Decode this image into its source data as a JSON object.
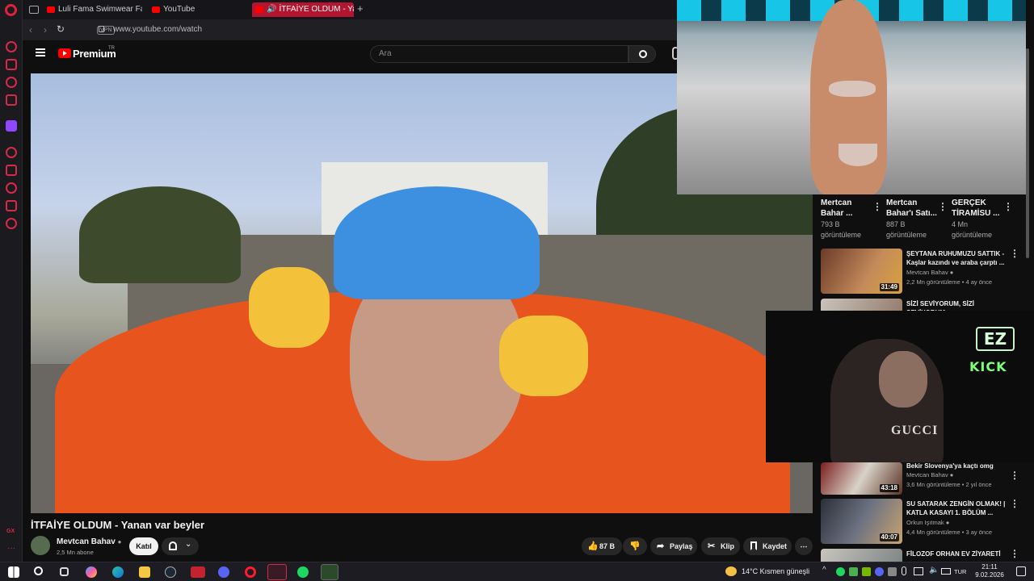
{
  "browser": {
    "tabs": [
      {
        "label": "Luli Fama Swimwear Fashi"
      },
      {
        "label": "YouTube"
      },
      {
        "label": "İTFAİYE OLDUM - Yanan"
      }
    ],
    "vpn_label": "VPN",
    "url": "www.youtube.com/watch"
  },
  "youtube": {
    "brand": "Premium",
    "region": "TR",
    "search_placeholder": "Ara"
  },
  "video": {
    "title": "İTFAİYE OLDUM - Yanan var beyler",
    "channel": "Mevtcan Bahav",
    "subscribers": "2,5 Mn abone",
    "join_label": "Katıl",
    "likes": "87 B",
    "share_label": "Paylaş",
    "clip_label": "Klip",
    "save_label": "Kaydet"
  },
  "stream_overlay": {
    "logo_text": "EZ",
    "platform_text": "KICK",
    "shirt_text": "GUCCI"
  },
  "shorts_chips": [
    {
      "title": "Mertcan",
      "title2": "Bahar ...",
      "views": "793 B",
      "views2": "görüntüleme"
    },
    {
      "title": "Mertcan",
      "title2": "Bahar'ı Satı...",
      "views": "887 B",
      "views2": "görüntüleme"
    },
    {
      "title": "GERÇEK",
      "title2": "TİRAMİSU ...",
      "views": "4 Mn",
      "views2": "görüntüleme"
    }
  ],
  "recommendations": [
    {
      "title": "ŞEYTANA RUHUMUZU SATTIK - Kaşlar kazındı ve araba çarptı ...",
      "channel": "Mevtcan Bahav",
      "meta": "2,2 Mn görüntüleme • 4 ay önce",
      "duration": "31:49"
    },
    {
      "title": "SİZİ SEVİYORUM, SİZİ SEVİYORUM",
      "channel": "",
      "meta": "",
      "duration": ""
    },
    {
      "title": "Bekir Slovenya'ya kaçtı omg",
      "channel": "Mevtcan Bahav",
      "meta": "3,6 Mn görüntüleme • 2 yıl önce",
      "duration": "43:18"
    },
    {
      "title": "SU SATARAK ZENGİN OLMAK! | KATLA KASAYI 1. BÖLÜM ...",
      "channel": "Orkun Işıtmak",
      "meta": "4,4 Mn görüntüleme • 3 ay önce",
      "duration": "40:07"
    },
    {
      "title": "FİLOZOF ORHAN EV ZİYARETİ",
      "channel": "",
      "meta": "",
      "duration": ""
    }
  ],
  "taskbar": {
    "weather": "14°C  Kısmen güneşli",
    "lang": "TUR",
    "time": "21:11",
    "date": "9.02.2026"
  },
  "colors": {
    "accent": "#b3142e",
    "yt_red": "#ff0000",
    "kick_green": "#7dff7a"
  }
}
